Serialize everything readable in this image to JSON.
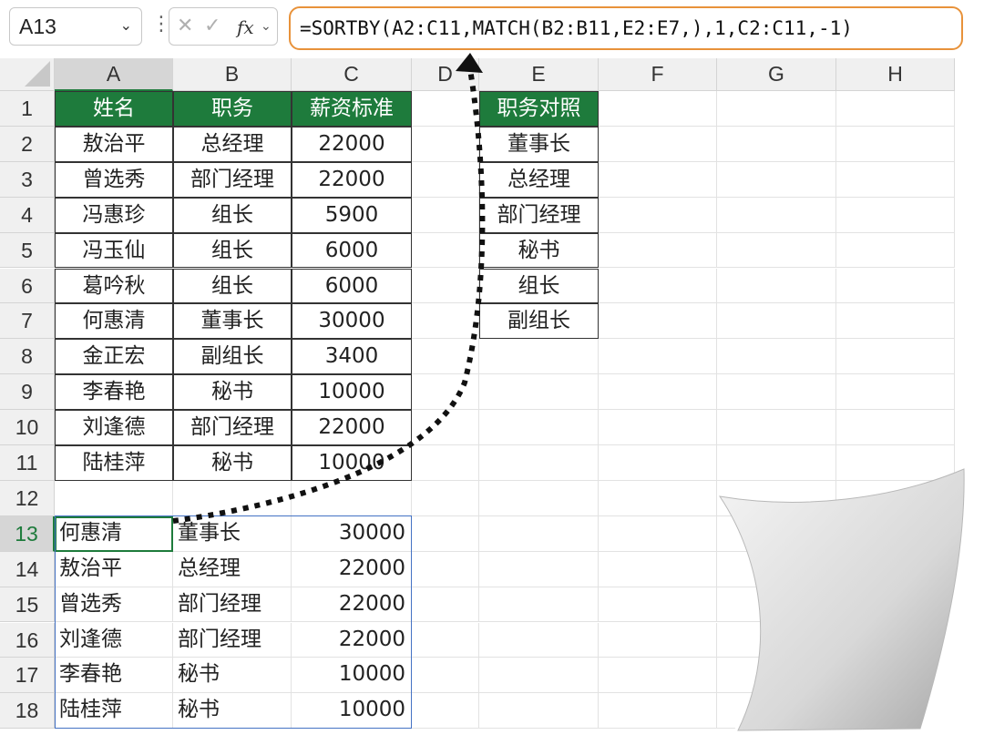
{
  "namebox": {
    "value": "A13"
  },
  "formula_bar": {
    "formula": "=SORTBY(A2:C11,MATCH(B2:B11,E2:E7,),1,C2:C11,-1)",
    "fx_label": "fx"
  },
  "columns": [
    "A",
    "B",
    "C",
    "D",
    "E",
    "F",
    "G",
    "H"
  ],
  "rows": [
    "1",
    "2",
    "3",
    "4",
    "5",
    "6",
    "7",
    "8",
    "9",
    "10",
    "11",
    "12",
    "13",
    "14",
    "15",
    "16",
    "17",
    "18"
  ],
  "source_table": {
    "headers": [
      "姓名",
      "职务",
      "薪资标准"
    ],
    "rows": [
      [
        "敖治平",
        "总经理",
        "22000"
      ],
      [
        "曾选秀",
        "部门经理",
        "22000"
      ],
      [
        "冯惠珍",
        "组长",
        "5900"
      ],
      [
        "冯玉仙",
        "组长",
        "6000"
      ],
      [
        "葛吟秋",
        "组长",
        "6000"
      ],
      [
        "何惠清",
        "董事长",
        "30000"
      ],
      [
        "金正宏",
        "副组长",
        "3400"
      ],
      [
        "李春艳",
        "秘书",
        "10000"
      ],
      [
        "刘逢德",
        "部门经理",
        "22000"
      ],
      [
        "陆桂萍",
        "秘书",
        "10000"
      ]
    ]
  },
  "lookup_table": {
    "header": "职务对照",
    "rows": [
      "董事长",
      "总经理",
      "部门经理",
      "秘书",
      "组长",
      "副组长"
    ]
  },
  "result_table": {
    "rows": [
      [
        "何惠清",
        "董事长",
        "30000"
      ],
      [
        "敖治平",
        "总经理",
        "22000"
      ],
      [
        "曾选秀",
        "部门经理",
        "22000"
      ],
      [
        "刘逢德",
        "部门经理",
        "22000"
      ],
      [
        "李春艳",
        "秘书",
        "10000"
      ],
      [
        "陆桂萍",
        "秘书",
        "10000"
      ]
    ]
  },
  "active_cell": "A13",
  "colors": {
    "header_green": "#1e7b3c",
    "formula_highlight": "#e8923a",
    "spill_border": "#4472c4"
  }
}
